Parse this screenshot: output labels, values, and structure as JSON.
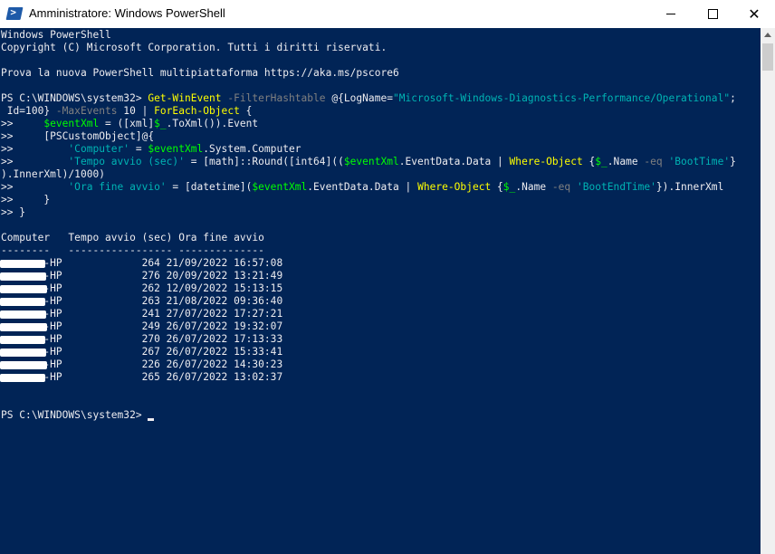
{
  "window": {
    "title": "Amministratore: Windows PowerShell",
    "icon": "powershell-icon",
    "icon_glyph": ">",
    "controls": {
      "close_glyph": "✕"
    }
  },
  "colors": {
    "console_bg": "#012456",
    "text": "#eeedf0",
    "cmdlet": "#ffff00",
    "parameter": "#808080",
    "string": "#00b4b4",
    "variable": "#00ff00"
  },
  "console": {
    "header": [
      "Windows PowerShell",
      "Copyright (C) Microsoft Corporation. Tutti i diritti riservati.",
      "",
      "Prova la nuova PowerShell multipiattaforma https://aka.ms/pscore6"
    ],
    "command_lines": [
      [
        {
          "t": "PS C:\\WINDOWS\\system32> ",
          "c": "txt"
        },
        {
          "t": "Get-WinEvent",
          "c": "cmd"
        },
        {
          "t": " -FilterHashtable",
          "c": "par"
        },
        {
          "t": " @{LogName=",
          "c": "txt"
        },
        {
          "t": "\"Microsoft-Windows-Diagnostics-Performance/Operational\"",
          "c": "str"
        },
        {
          "t": ";",
          "c": "txt"
        }
      ],
      [
        {
          "t": " Id=100}",
          "c": "txt"
        },
        {
          "t": " -MaxEvents",
          "c": "par"
        },
        {
          "t": " 10 | ",
          "c": "txt"
        },
        {
          "t": "ForEach-Object",
          "c": "cmd"
        },
        {
          "t": " {",
          "c": "txt"
        }
      ],
      [
        {
          "t": ">>     ",
          "c": "txt"
        },
        {
          "t": "$eventXml",
          "c": "var"
        },
        {
          "t": " = ([xml]",
          "c": "txt"
        },
        {
          "t": "$_",
          "c": "var"
        },
        {
          "t": ".ToXml()).Event",
          "c": "txt"
        }
      ],
      [
        {
          "t": ">>     [PSCustomObject]@{",
          "c": "txt"
        }
      ],
      [
        {
          "t": ">>         ",
          "c": "txt"
        },
        {
          "t": "'Computer'",
          "c": "str"
        },
        {
          "t": " = ",
          "c": "txt"
        },
        {
          "t": "$eventXml",
          "c": "var"
        },
        {
          "t": ".System.Computer",
          "c": "txt"
        }
      ],
      [
        {
          "t": ">>         ",
          "c": "txt"
        },
        {
          "t": "'Tempo avvio (sec)'",
          "c": "str"
        },
        {
          "t": " = [math]::Round([int64]((",
          "c": "txt"
        },
        {
          "t": "$eventXml",
          "c": "var"
        },
        {
          "t": ".EventData.Data | ",
          "c": "txt"
        },
        {
          "t": "Where-Object",
          "c": "cmd"
        },
        {
          "t": " {",
          "c": "txt"
        },
        {
          "t": "$_",
          "c": "var"
        },
        {
          "t": ".Name",
          "c": "txt"
        },
        {
          "t": " -eq",
          "c": "par"
        },
        {
          "t": " ",
          "c": "txt"
        },
        {
          "t": "'BootTime'",
          "c": "str"
        },
        {
          "t": "}",
          "c": "txt"
        }
      ],
      [
        {
          "t": ").InnerXml)/1000)",
          "c": "txt"
        }
      ],
      [
        {
          "t": ">>         ",
          "c": "txt"
        },
        {
          "t": "'Ora fine avvio'",
          "c": "str"
        },
        {
          "t": " = [datetime](",
          "c": "txt"
        },
        {
          "t": "$eventXml",
          "c": "var"
        },
        {
          "t": ".EventData.Data | ",
          "c": "txt"
        },
        {
          "t": "Where-Object",
          "c": "cmd"
        },
        {
          "t": " {",
          "c": "txt"
        },
        {
          "t": "$_",
          "c": "var"
        },
        {
          "t": ".Name",
          "c": "txt"
        },
        {
          "t": " -eq",
          "c": "par"
        },
        {
          "t": " ",
          "c": "txt"
        },
        {
          "t": "'BootEndTime'",
          "c": "str"
        },
        {
          "t": "}).InnerXml",
          "c": "txt"
        }
      ],
      [
        {
          "t": ">>     }",
          "c": "txt"
        }
      ],
      [
        {
          "t": ">> }",
          "c": "txt"
        }
      ]
    ],
    "table": {
      "header": "Computer   Tempo avvio (sec) Ora fine avvio",
      "separator": "--------   ----------------- --------------",
      "rows": [
        {
          "computer": "-HP",
          "boot_sec": "264",
          "end_time": "21/09/2022 16:57:08"
        },
        {
          "computer": "-HP",
          "boot_sec": "276",
          "end_time": "20/09/2022 13:21:49"
        },
        {
          "computer": "-HP",
          "boot_sec": "262",
          "end_time": "12/09/2022 15:13:15"
        },
        {
          "computer": "-HP",
          "boot_sec": "263",
          "end_time": "21/08/2022 09:36:40"
        },
        {
          "computer": "-HP",
          "boot_sec": "241",
          "end_time": "27/07/2022 17:27:21"
        },
        {
          "computer": "-HP",
          "boot_sec": "249",
          "end_time": "26/07/2022 19:32:07"
        },
        {
          "computer": "-HP",
          "boot_sec": "270",
          "end_time": "26/07/2022 17:13:33"
        },
        {
          "computer": "-HP",
          "boot_sec": "267",
          "end_time": "26/07/2022 15:33:41"
        },
        {
          "computer": "-HP",
          "boot_sec": "226",
          "end_time": "26/07/2022 14:30:23"
        },
        {
          "computer": "-HP",
          "boot_sec": "265",
          "end_time": "26/07/2022 13:02:37"
        }
      ]
    },
    "prompt": "PS C:\\WINDOWS\\system32> "
  }
}
